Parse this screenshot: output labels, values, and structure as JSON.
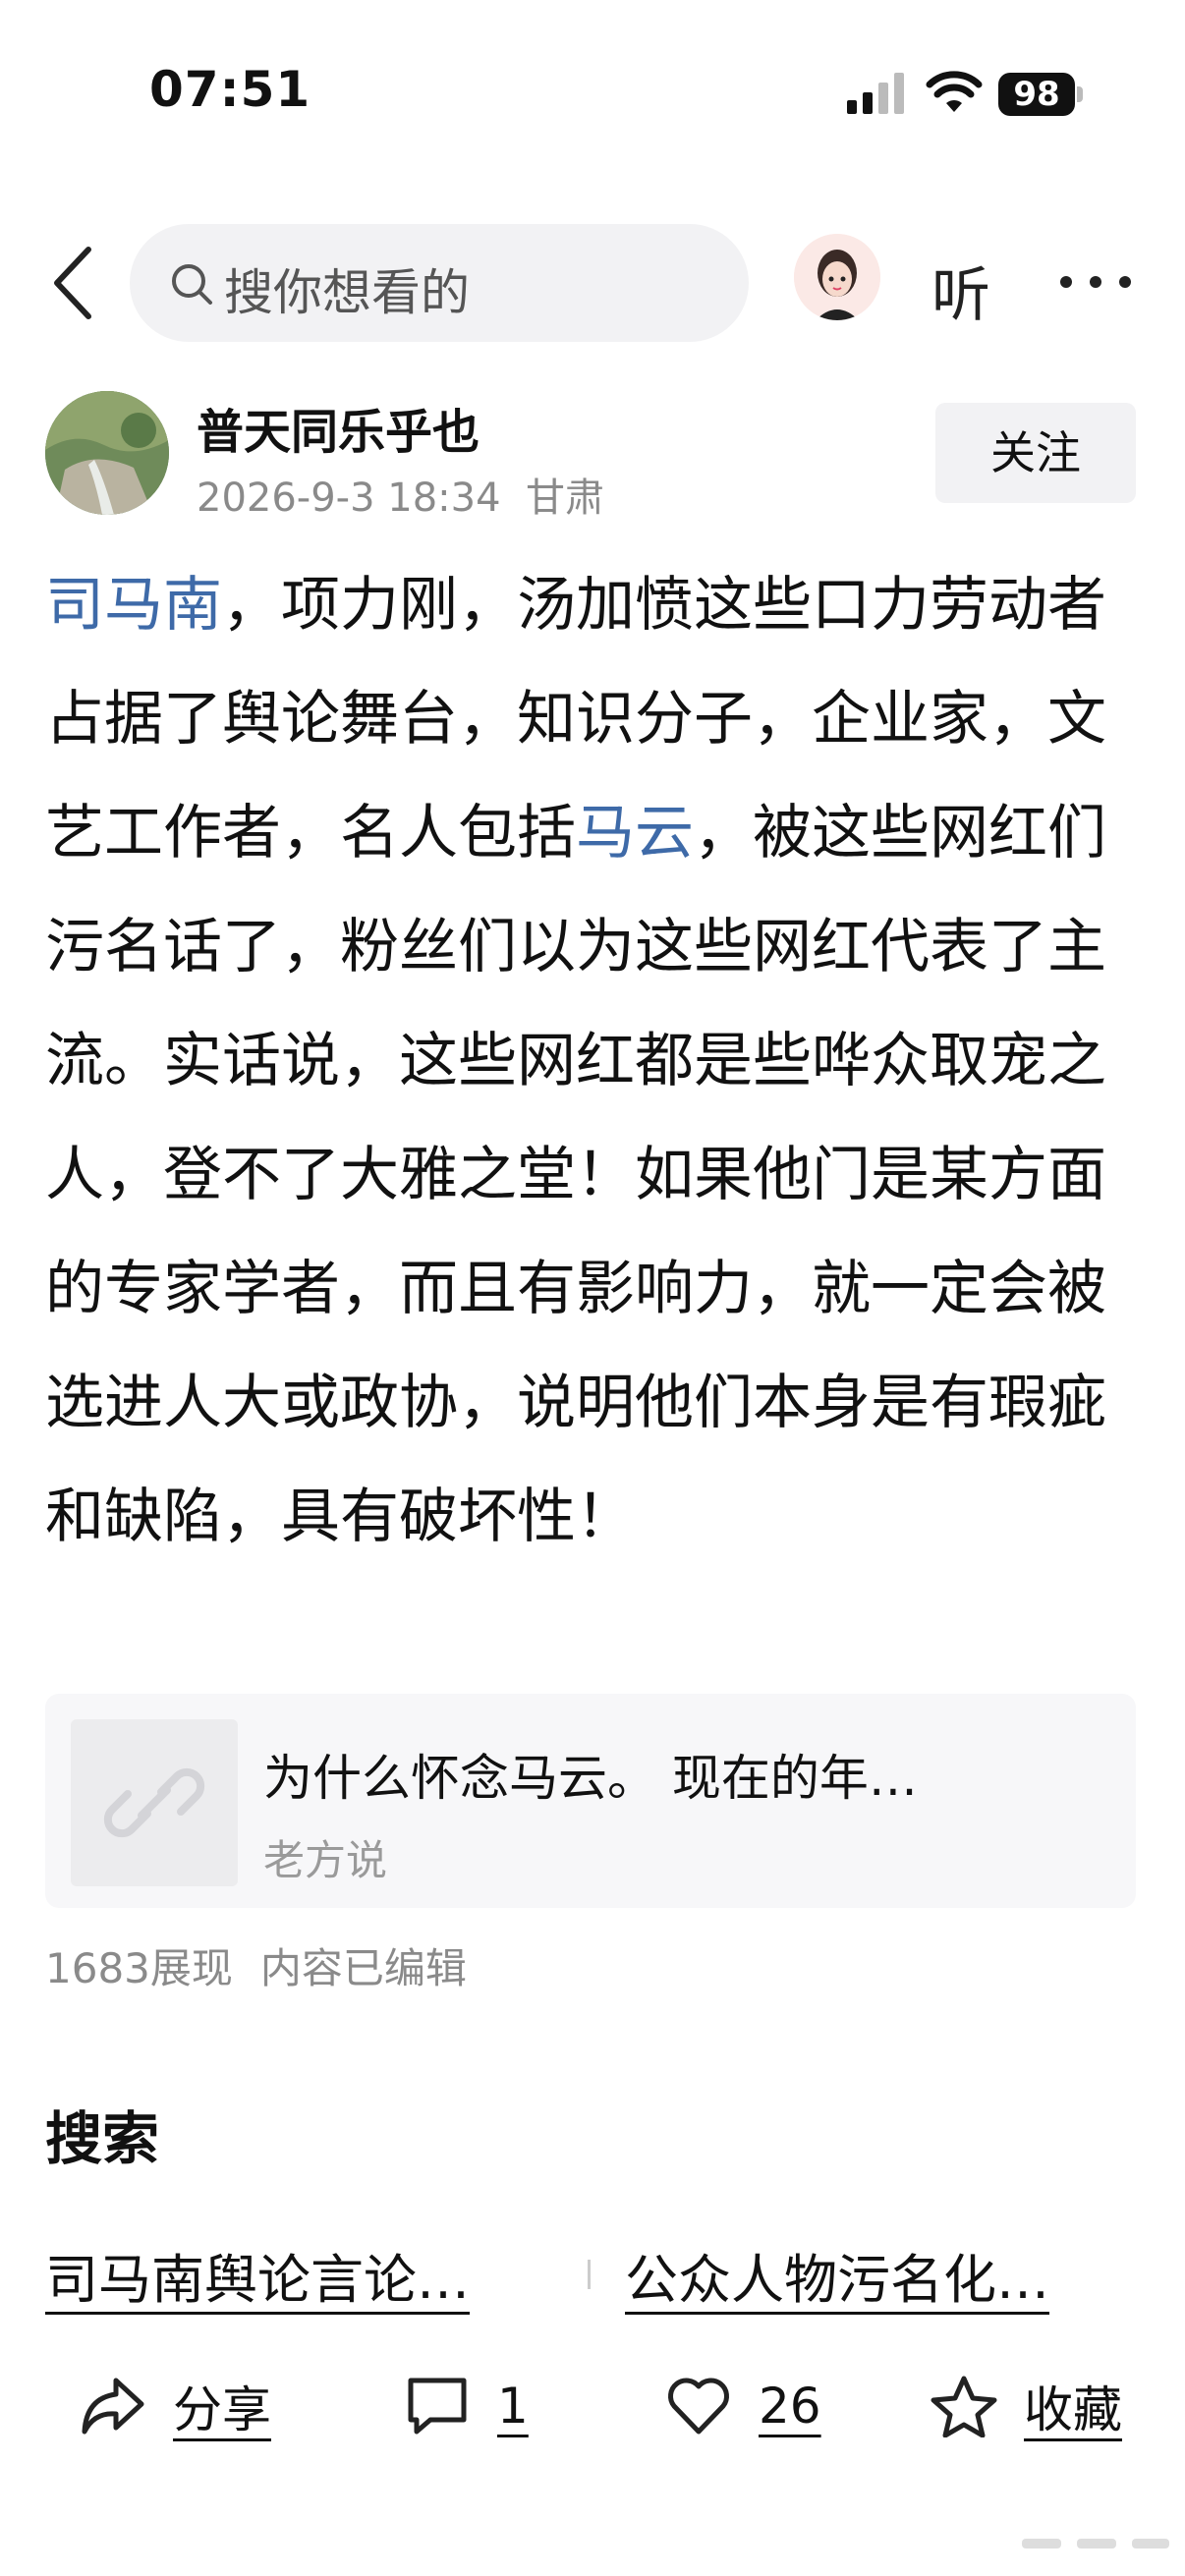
{
  "status_bar": {
    "time": "07:51",
    "battery": "98"
  },
  "nav": {
    "search_placeholder": "搜你想看的",
    "listen_label": "听"
  },
  "author": {
    "name": "普天同乐乎也",
    "date": "2026-9-3 18:34",
    "location": "甘肃",
    "follow_label": "关注"
  },
  "post": {
    "segments": [
      {
        "text": "司马南",
        "highlight": true
      },
      {
        "text": "，项力刚，汤加愤这些口力劳动者占据了舆论舞台，知识分子，企业家，文艺工作者，名人包括",
        "highlight": false
      },
      {
        "text": "马云",
        "highlight": true
      },
      {
        "text": "，被这些网红们污名话了，粉丝们以为这些网红代表了主流。实话说，这些网红都是些哗众取宠之人，登不了大雅之堂！如果他门是某方面的专家学者，而且有影响力，就一定会被选进人大或政协，说明他们本身是有瑕疵和缺陷，具有破坏性！",
        "highlight": false
      }
    ],
    "link_card": {
      "title": "为什么怀念马云。 现在的年…",
      "source": "老方说"
    },
    "views": "1683展现",
    "edited": "内容已编辑"
  },
  "search_section": {
    "heading": "搜索",
    "suggestions": [
      "司马南舆论言论…",
      "公众人物污名化…"
    ]
  },
  "actions": {
    "share_label": "分享",
    "comment_count": "1",
    "like_count": "26",
    "favorite_label": "收藏"
  },
  "colors": {
    "highlight": "#3e6aa8",
    "search_bg": "#f2f2f4"
  },
  "icons": [
    "signal-icon",
    "wifi-icon",
    "back-icon",
    "search-icon",
    "more-icon",
    "link-icon",
    "share-icon",
    "comment-icon",
    "heart-icon",
    "star-icon"
  ]
}
